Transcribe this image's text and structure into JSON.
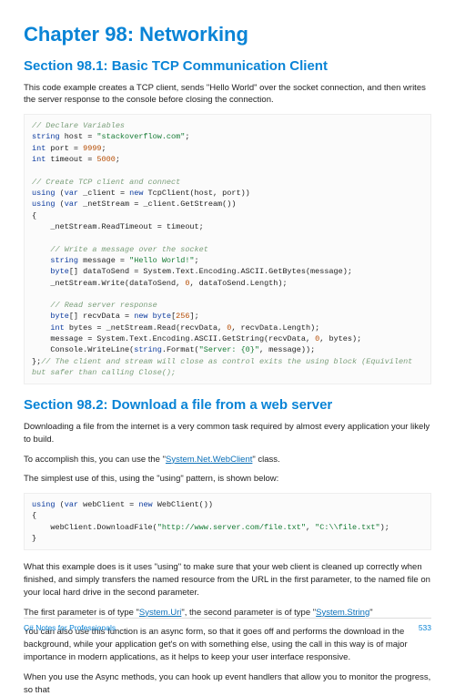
{
  "chapter": {
    "title": "Chapter 98: Networking"
  },
  "section1": {
    "title": "Section 98.1: Basic TCP Communication Client",
    "intro": "This code example creates a TCP client, sends \"Hello World\" over the socket connection, and then writes the server response to the console before closing the connection."
  },
  "code1": {
    "c1": "// Declare Variables",
    "host_pre": "string",
    "host_var": " host = ",
    "host_val": "\"stackoverflow.com\"",
    "port_pre": "int",
    "port_var": " port = ",
    "port_val": "9999",
    "timeout_pre": "int",
    "timeout_var": " timeout = ",
    "timeout_val": "5000",
    "c2": "// Create TCP client and connect",
    "u1a": "using",
    "u1b": " (",
    "u1c": "var",
    "u1d": " _client = ",
    "u1e": "new",
    "u1f": " TcpClient(host, port))",
    "u2a": "using",
    "u2b": " (",
    "u2c": "var",
    "u2d": " _netStream = _client.GetStream())",
    "lb": "{",
    "rt": "    _netStream.ReadTimeout = timeout;",
    "c3": "    // Write a message over the socket",
    "m1a": "    string",
    "m1b": " message = ",
    "m1c": "\"Hello World!\"",
    "m2a": "    byte",
    "m2b": "[] dataToSend = System.Text.Encoding.ASCII.GetBytes(message);",
    "m3a": "    _netStream.Write(dataToSend, ",
    "m3b": "0",
    "m3c": ", dataToSend.Length);",
    "c4": "    // Read server response",
    "r1a": "    byte",
    "r1b": "[] recvData = ",
    "r1c": "new",
    "r1d": " byte",
    "r1e": "[",
    "r1f": "256",
    "r1g": "];",
    "r2a": "    int",
    "r2b": " bytes = _netStream.Read(recvData, ",
    "r2c": "0",
    "r2d": ", recvData.Length);",
    "r3a": "    message = System.Text.Encoding.ASCII.GetString(recvData, ",
    "r3b": "0",
    "r3c": ", bytes);",
    "r4a": "    Console.WriteLine(",
    "r4b": "string",
    "r4c": ".Format(",
    "r4d": "\"Server: {0}\"",
    "r4e": ", message));",
    "rb": "};",
    "cend": "// The client and stream will close as control exits the using block (Equivilent but safer than calling Close();"
  },
  "section2": {
    "title": "Section 98.2: Download a file from a web server",
    "p1": "Downloading a file from the internet is a very common task required by almost every application your likely to build.",
    "p2a": "To accomplish this, you can use the \"",
    "p2link": "System.Net.WebClient",
    "p2b": "\" class.",
    "p3": "The simplest use of this, using the \"using\" pattern, is shown below:"
  },
  "code2": {
    "a": "using",
    "b": " (",
    "c": "var",
    "d": " webClient = ",
    "e": "new",
    "f": " WebClient())",
    "lb": "{",
    "g": "    webClient.DownloadFile(",
    "url": "\"http://www.server.com/file.txt\"",
    "h": ", ",
    "path": "\"C:\\\\file.txt\"",
    "i": ");",
    "rb": "}"
  },
  "section2b": {
    "p4": "What this example does is it uses \"using\" to make sure that your web client is cleaned up correctly when finished, and simply transfers the named resource from the URL in the first parameter, to the named file on your local hard drive in the second parameter.",
    "p5a": "The first parameter is of type \"",
    "p5link1": "System.Uri",
    "p5b": "\", the second parameter is of type \"",
    "p5link2": "System.String",
    "p5c": "\"",
    "p6": "You can also use this function is an async form, so that it goes off and performs the download in the background, while your application get's on with something else, using the call in this way is of major importance in modern applications, as it helps to keep your user interface responsive.",
    "p7": "When you use the Async methods, you can hook up event handlers that allow you to monitor the progress, so that"
  },
  "footer": {
    "left": "C# Notes for Professionals",
    "right": "533"
  }
}
